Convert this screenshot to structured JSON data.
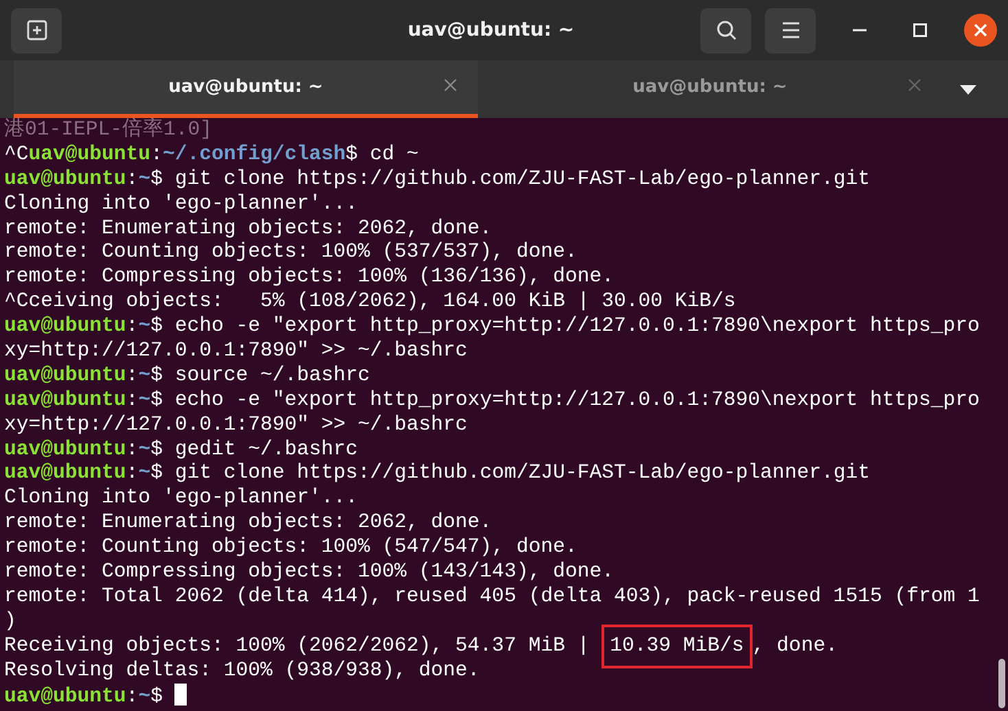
{
  "window": {
    "title": "uav@ubuntu: ~"
  },
  "tabs": [
    {
      "label": "uav@ubuntu: ~",
      "selected": true
    },
    {
      "label": "uav@ubuntu: ~",
      "selected": false
    }
  ],
  "terminal": {
    "cursor": true,
    "lines": [
      [
        {
          "text": "港01-IEPL-倍率1.0]",
          "kind": "dim"
        }
      ],
      [
        {
          "text": "^C",
          "kind": "plain"
        },
        {
          "text": "uav@ubuntu",
          "kind": "user"
        },
        {
          "text": ":",
          "kind": "plain"
        },
        {
          "text": "~/.config/clash",
          "kind": "path"
        },
        {
          "text": "$ cd ~",
          "kind": "plain"
        }
      ],
      [
        {
          "text": "uav@ubuntu",
          "kind": "user"
        },
        {
          "text": ":",
          "kind": "plain"
        },
        {
          "text": "~",
          "kind": "path"
        },
        {
          "text": "$ git clone https://github.com/ZJU-FAST-Lab/ego-planner.git",
          "kind": "plain"
        }
      ],
      [
        {
          "text": "Cloning into 'ego-planner'...",
          "kind": "plain"
        }
      ],
      [
        {
          "text": "remote: Enumerating objects: 2062, done.",
          "kind": "plain"
        }
      ],
      [
        {
          "text": "remote: Counting objects: 100% (537/537), done.",
          "kind": "plain"
        }
      ],
      [
        {
          "text": "remote: Compressing objects: 100% (136/136), done.",
          "kind": "plain"
        }
      ],
      [
        {
          "text": "^Cceiving objects:   5% (108/2062), 164.00 KiB | 30.00 KiB/s",
          "kind": "plain"
        }
      ],
      [
        {
          "text": "uav@ubuntu",
          "kind": "user"
        },
        {
          "text": ":",
          "kind": "plain"
        },
        {
          "text": "~",
          "kind": "path"
        },
        {
          "text": "$ echo -e \"export http_proxy=http://127.0.0.1:7890\\nexport https_pro",
          "kind": "plain"
        }
      ],
      [
        {
          "text": "xy=http://127.0.0.1:7890\" >> ~/.bashrc",
          "kind": "plain"
        }
      ],
      [
        {
          "text": "uav@ubuntu",
          "kind": "user"
        },
        {
          "text": ":",
          "kind": "plain"
        },
        {
          "text": "~",
          "kind": "path"
        },
        {
          "text": "$ source ~/.bashrc",
          "kind": "plain"
        }
      ],
      [
        {
          "text": "uav@ubuntu",
          "kind": "user"
        },
        {
          "text": ":",
          "kind": "plain"
        },
        {
          "text": "~",
          "kind": "path"
        },
        {
          "text": "$ echo -e \"export http_proxy=http://127.0.0.1:7890\\nexport https_pro",
          "kind": "plain"
        }
      ],
      [
        {
          "text": "xy=http://127.0.0.1:7890\" >> ~/.bashrc",
          "kind": "plain"
        }
      ],
      [
        {
          "text": "uav@ubuntu",
          "kind": "user"
        },
        {
          "text": ":",
          "kind": "plain"
        },
        {
          "text": "~",
          "kind": "path"
        },
        {
          "text": "$ gedit ~/.bashrc",
          "kind": "plain"
        }
      ],
      [
        {
          "text": "uav@ubuntu",
          "kind": "user"
        },
        {
          "text": ":",
          "kind": "plain"
        },
        {
          "text": "~",
          "kind": "path"
        },
        {
          "text": "$ git clone https://github.com/ZJU-FAST-Lab/ego-planner.git",
          "kind": "plain"
        }
      ],
      [
        {
          "text": "Cloning into 'ego-planner'...",
          "kind": "plain"
        }
      ],
      [
        {
          "text": "remote: Enumerating objects: 2062, done.",
          "kind": "plain"
        }
      ],
      [
        {
          "text": "remote: Counting objects: 100% (547/547), done.",
          "kind": "plain"
        }
      ],
      [
        {
          "text": "remote: Compressing objects: 100% (143/143), done.",
          "kind": "plain"
        }
      ],
      [
        {
          "text": "remote: Total 2062 (delta 414), reused 405 (delta 403), pack-reused 1515 (from 1",
          "kind": "plain"
        }
      ],
      [
        {
          "text": ")",
          "kind": "plain"
        }
      ],
      [
        {
          "text": "Receiving objects: 100% (2062/2062), 54.37 MiB | ",
          "kind": "plain"
        },
        {
          "text": "10.39 MiB/s",
          "kind": "highlight"
        },
        {
          "text": ", done.",
          "kind": "plain"
        }
      ],
      [
        {
          "text": "Resolving deltas: 100% (938/938), done.",
          "kind": "plain"
        }
      ],
      [
        {
          "text": "uav@ubuntu",
          "kind": "user"
        },
        {
          "text": ":",
          "kind": "plain"
        },
        {
          "text": "~",
          "kind": "path"
        },
        {
          "text": "$ ",
          "kind": "plain"
        }
      ]
    ]
  }
}
